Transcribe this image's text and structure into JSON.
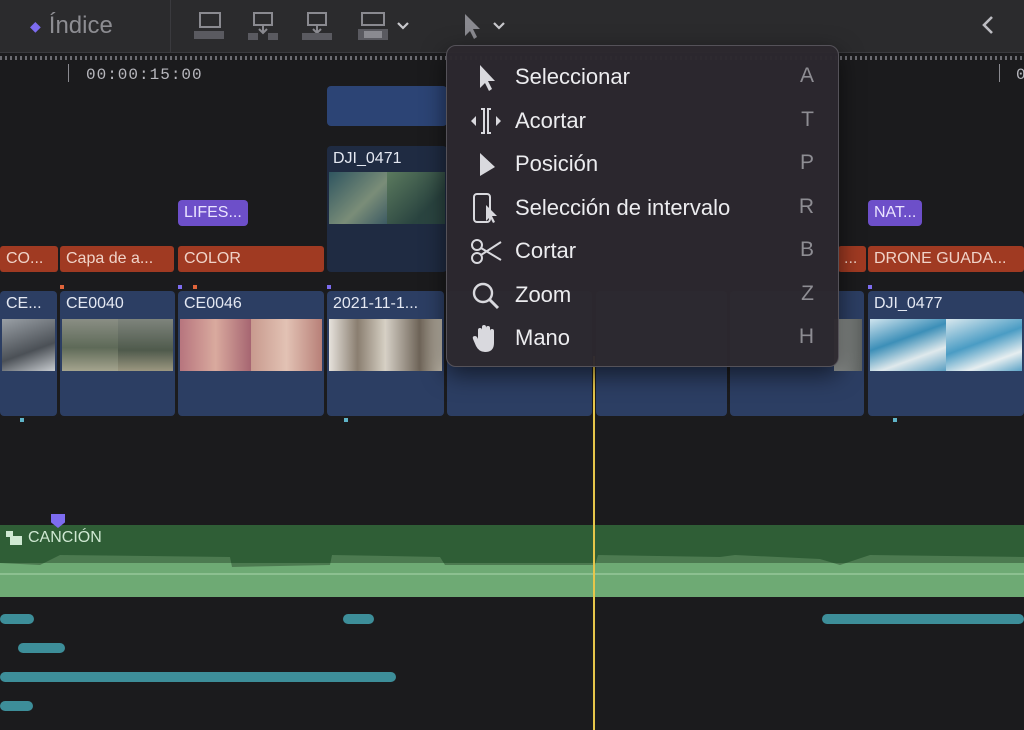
{
  "toolbar": {
    "index_label": "Índice",
    "icons": [
      "append-clip-icon",
      "insert-clip-icon",
      "connect-clip-icon",
      "overwrite-clip-icon",
      "select-tool-icon"
    ]
  },
  "ruler": {
    "timecode_left": "00:00:15:00",
    "timecode_right": "0"
  },
  "clips_upper": [
    {
      "name": "DJI_0471"
    }
  ],
  "tags": [
    {
      "text": "LIFES..."
    },
    {
      "text": "NAT..."
    }
  ],
  "title_clips": [
    {
      "text": "CO..."
    },
    {
      "text": "Capa de a..."
    },
    {
      "text": "COLOR"
    },
    {
      "text": "..."
    },
    {
      "text": "DRONE GUADA..."
    }
  ],
  "clips": [
    {
      "name": "CE..."
    },
    {
      "name": "CE0040"
    },
    {
      "name": "CE0046"
    },
    {
      "name": "2021-11-1..."
    },
    {
      "name": ""
    },
    {
      "name": ""
    },
    {
      "name": ""
    },
    {
      "name": "DJI_0477"
    }
  ],
  "audio": {
    "label": "CANCIÓN"
  },
  "tool_menu": {
    "items": [
      {
        "label": "Seleccionar",
        "key": "A",
        "icon": "arrow-pointer-icon"
      },
      {
        "label": "Acortar",
        "key": "T",
        "icon": "trim-icon"
      },
      {
        "label": "Posición",
        "key": "P",
        "icon": "position-icon"
      },
      {
        "label": "Selección de intervalo",
        "key": "R",
        "icon": "range-selection-icon"
      },
      {
        "label": "Cortar",
        "key": "B",
        "icon": "scissors-icon"
      },
      {
        "label": "Zoom",
        "key": "Z",
        "icon": "magnifier-icon"
      },
      {
        "label": "Mano",
        "key": "H",
        "icon": "hand-icon"
      }
    ]
  },
  "colors": {
    "accent": "#7d6cf0",
    "playhead": "#e6c64a",
    "clip": "#2c3e63",
    "title": "#a03a22",
    "audio": "#2f5e36"
  }
}
